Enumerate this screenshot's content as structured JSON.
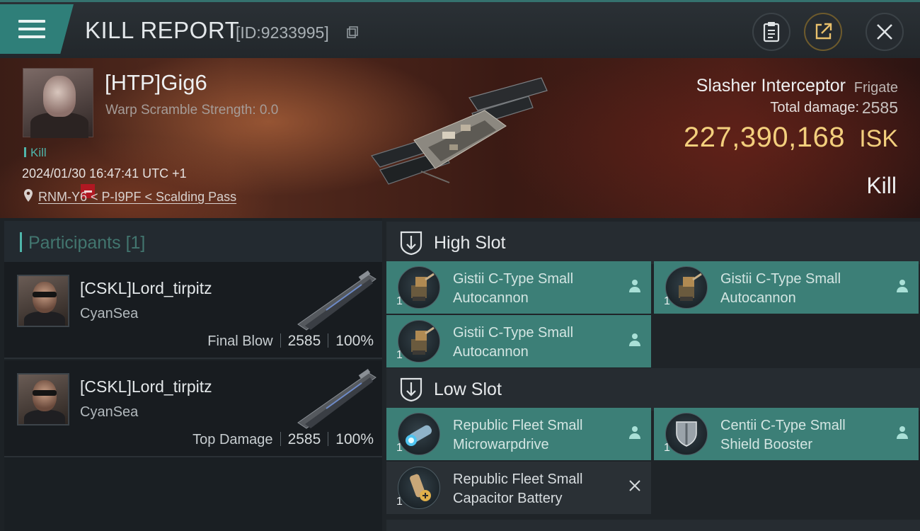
{
  "header": {
    "title": "KILL REPORT",
    "report_id": "[ID:9233995]",
    "icons": [
      "menu-icon",
      "copy-icon",
      "clipboard-icon",
      "share-icon",
      "close-icon"
    ]
  },
  "victim": {
    "name": "[HTP]Gig6",
    "warp_scramble": "Warp Scramble Strength: 0.0",
    "kill_tag": "Kill",
    "datetime": "2024/01/30 16:47:41 UTC +1",
    "location": "RNM-Y6 < P-I9PF < Scalding Pass",
    "ship_name": "Slasher Interceptor",
    "ship_class": "Frigate",
    "total_damage_label": "Total damage:",
    "total_damage": "2585",
    "isk_value": "227,390,168",
    "isk_unit": "ISK",
    "result": "Kill"
  },
  "participants": {
    "title": "Participants",
    "count": "[1]",
    "rows": [
      {
        "name": "[CSKL]Lord_tirpitz",
        "corp": "CyanSea",
        "role": "Final Blow",
        "damage": "2585",
        "percent": "100%"
      },
      {
        "name": "[CSKL]Lord_tirpitz",
        "corp": "CyanSea",
        "role": "Top Damage",
        "damage": "2585",
        "percent": "100%"
      }
    ]
  },
  "slots": {
    "high_label": "High Slot",
    "low_label": "Low Slot",
    "high": [
      {
        "qty": "1",
        "line1": "Gistii C-Type Small",
        "line2": "Autocannon",
        "status": "person-icon"
      },
      {
        "qty": "1",
        "line1": "Gistii C-Type Small",
        "line2": "Autocannon",
        "status": "person-icon"
      },
      {
        "qty": "1",
        "line1": "Gistii C-Type Small",
        "line2": "Autocannon",
        "status": "person-icon"
      }
    ],
    "low": [
      {
        "qty": "1",
        "line1": "Republic Fleet Small",
        "line2": "Microwarpdrive",
        "status": "person-icon"
      },
      {
        "qty": "1",
        "line1": "Centii C-Type Small",
        "line2": "Shield Booster",
        "status": "person-icon"
      },
      {
        "qty": "1",
        "line1": "Republic Fleet Small",
        "line2": "Capacitor Battery",
        "status": "destroyed-x-icon"
      }
    ]
  },
  "colors": {
    "accent_teal": "#3c7f77",
    "isk_gold": "#f3cf7d",
    "badge_red": "#b01822"
  }
}
